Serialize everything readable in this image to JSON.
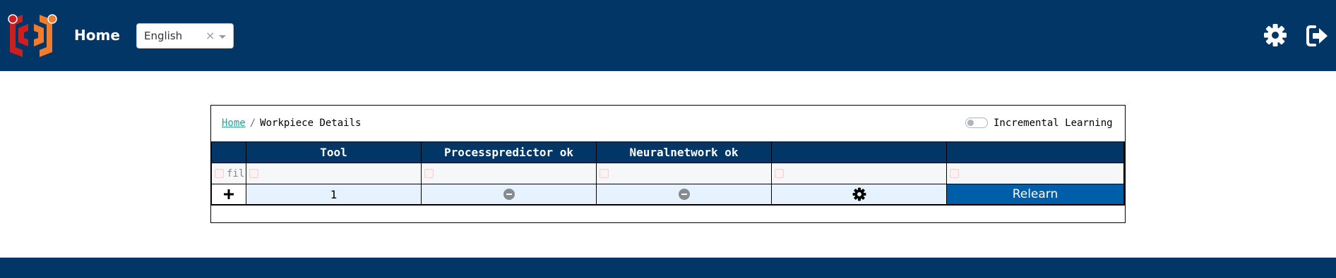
{
  "header": {
    "home_label": "Home",
    "language": {
      "selected": "English",
      "clear_glyph": "×"
    },
    "icons": [
      "logo-icon",
      "settings-gear-icon",
      "logout-icon"
    ]
  },
  "breadcrumb": {
    "home": "Home",
    "separator": "/",
    "current": "Workpiece Details"
  },
  "toggle": {
    "label": "Incremental Learning",
    "checked": false
  },
  "grid": {
    "columns": [
      "",
      "Tool",
      "Processpredictor ok",
      "Neuralnetwork ok",
      "",
      ""
    ],
    "filter_placeholder": "fil",
    "rows": [
      {
        "expand": "+",
        "tool": "1",
        "processpredictor_status": "minus-circle-icon",
        "neuralnetwork_status": "minus-circle-icon",
        "action_icon": "gear-icon",
        "relearn": "Relearn"
      }
    ]
  },
  "colors": {
    "navy": "#023666",
    "relearn_button": "#005da8",
    "row_highlight": "#e6f2fe",
    "link": "#2aa198"
  }
}
